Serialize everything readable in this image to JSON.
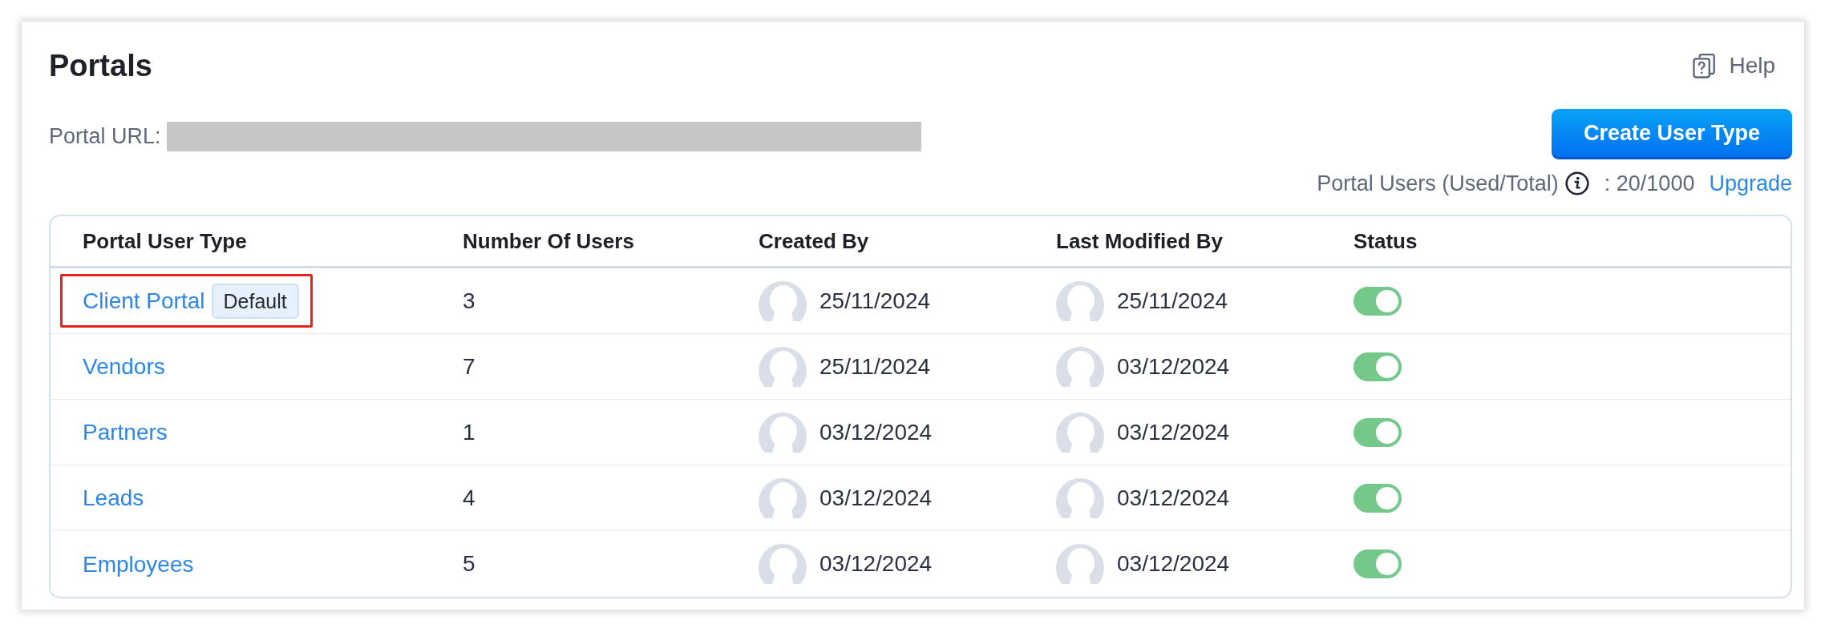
{
  "page": {
    "title": "Portals",
    "help_label": "Help"
  },
  "portal_url": {
    "label": "Portal URL:",
    "redacted": true
  },
  "create_button": {
    "label": "Create User Type"
  },
  "usage": {
    "label": "Portal Users (Used/Total)",
    "value": ": 20/1000",
    "upgrade_link": "Upgrade"
  },
  "table": {
    "columns": [
      "Portal User Type",
      "Number Of Users",
      "Created By",
      "Last Modified By",
      "Status"
    ],
    "rows": [
      {
        "name": "Client Portal",
        "badge": "Default",
        "highlighted": true,
        "users": "3",
        "created_by": "25/11/2024",
        "last_modified_by": "25/11/2024",
        "on": true
      },
      {
        "name": "Vendors",
        "highlighted": false,
        "users": "7",
        "created_by": "25/11/2024",
        "last_modified_by": "03/12/2024",
        "on": true
      },
      {
        "name": "Partners",
        "highlighted": false,
        "users": "1",
        "created_by": "03/12/2024",
        "last_modified_by": "03/12/2024",
        "on": true
      },
      {
        "name": "Leads",
        "highlighted": false,
        "users": "4",
        "created_by": "03/12/2024",
        "last_modified_by": "03/12/2024",
        "on": true
      },
      {
        "name": "Employees",
        "highlighted": false,
        "users": "5",
        "created_by": "03/12/2024",
        "last_modified_by": "03/12/2024",
        "on": true
      }
    ]
  }
}
